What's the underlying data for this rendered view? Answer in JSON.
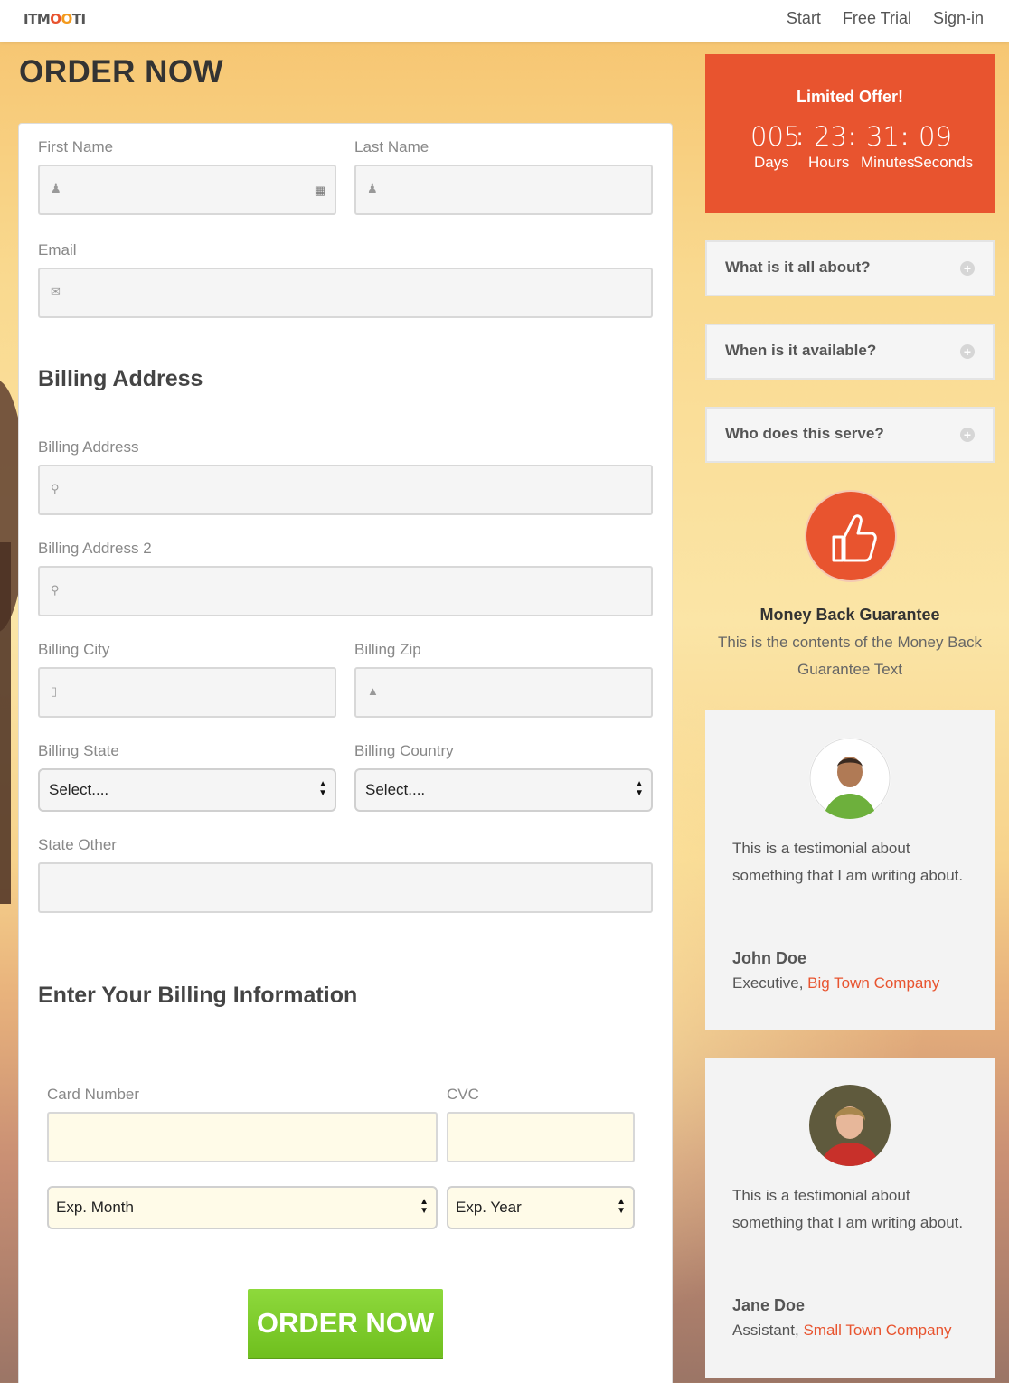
{
  "header": {
    "logo": {
      "part1": "ITM",
      "part2": "O",
      "part3": "O",
      "part4": "TI"
    },
    "nav": [
      "Start",
      "Free Trial",
      "Sign-in"
    ]
  },
  "page_title": "ORDER NOW",
  "form": {
    "first_name_label": "First Name",
    "last_name_label": "Last Name",
    "email_label": "Email",
    "billing_section_title": "Billing Address",
    "billing_address_label": "Billing Address",
    "billing_address2_label": "Billing Address 2",
    "billing_city_label": "Billing City",
    "billing_zip_label": "Billing Zip",
    "billing_state_label": "Billing State",
    "billing_country_label": "Billing Country",
    "state_select_value": "Select....",
    "country_select_value": "Select....",
    "state_other_label": "State Other",
    "billing_info_title": "Enter Your Billing Information",
    "card_number_label": "Card Number",
    "cvc_label": "CVC",
    "exp_month_value": "Exp. Month",
    "exp_year_value": "Exp. Year",
    "order_button": "ORDER NOW"
  },
  "offer": {
    "title": "Limited Offer!",
    "days": "005",
    "hours": "23",
    "minutes": "31",
    "seconds": "09",
    "sep": ":",
    "days_label": "Days",
    "hours_label": "Hours",
    "minutes_label": "Minutes",
    "seconds_label": "Seconds"
  },
  "faq": [
    "What is it all about?",
    "When is it available?",
    "Who does this serve?"
  ],
  "guarantee": {
    "title": "Money Back Guarantee",
    "text": "This is the contents of the Money Back Guarantee Text"
  },
  "testimonials": [
    {
      "text": "This is a testimonial about something that I am writing about.",
      "name": "John Doe",
      "role": "Executive,",
      "company": "Big Town Company"
    },
    {
      "text": "This is a testimonial about something that I am writing about.",
      "name": "Jane Doe",
      "role": "Assistant,",
      "company": "Small Town Company"
    }
  ],
  "colors": {
    "accent": "#e8542f",
    "order_button": "#7cc72a",
    "card_field_bg": "#fffbe8"
  }
}
